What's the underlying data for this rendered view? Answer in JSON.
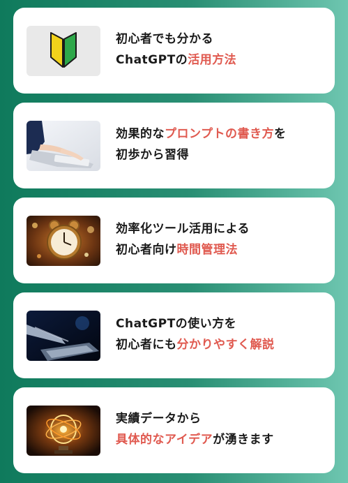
{
  "cards": [
    {
      "icon": "beginner-mark-icon",
      "line1": [
        {
          "text": "初心者でも分かる",
          "hl": false
        }
      ],
      "line2": [
        {
          "text": "ChatGPTの",
          "hl": false
        },
        {
          "text": "活用方法",
          "hl": true
        }
      ]
    },
    {
      "icon": "typing-keyboard-photo",
      "line1": [
        {
          "text": "効果的な",
          "hl": false
        },
        {
          "text": "プロンプトの書き方",
          "hl": true
        },
        {
          "text": "を",
          "hl": false
        }
      ],
      "line2": [
        {
          "text": "初歩から習得",
          "hl": false
        }
      ]
    },
    {
      "icon": "alarm-clock-photo",
      "line1": [
        {
          "text": "効率化ツール活用による",
          "hl": false
        }
      ],
      "line2": [
        {
          "text": "初心者向け",
          "hl": false
        },
        {
          "text": "時間管理法",
          "hl": true
        }
      ]
    },
    {
      "icon": "robot-hand-laptop-photo",
      "line1": [
        {
          "text": "ChatGPTの使い方を",
          "hl": false
        }
      ],
      "line2": [
        {
          "text": "初心者にも",
          "hl": false
        },
        {
          "text": "分かりやすく解説",
          "hl": true
        }
      ]
    },
    {
      "icon": "glowing-bulb-photo",
      "line1": [
        {
          "text": "実績データから",
          "hl": false
        }
      ],
      "line2": [
        {
          "text": "具体的なアイデア",
          "hl": true
        },
        {
          "text": "が湧きます",
          "hl": false
        }
      ]
    }
  ],
  "colors": {
    "highlight": "#e05a50",
    "text": "#1a1a1a",
    "card_bg": "#ffffff"
  }
}
